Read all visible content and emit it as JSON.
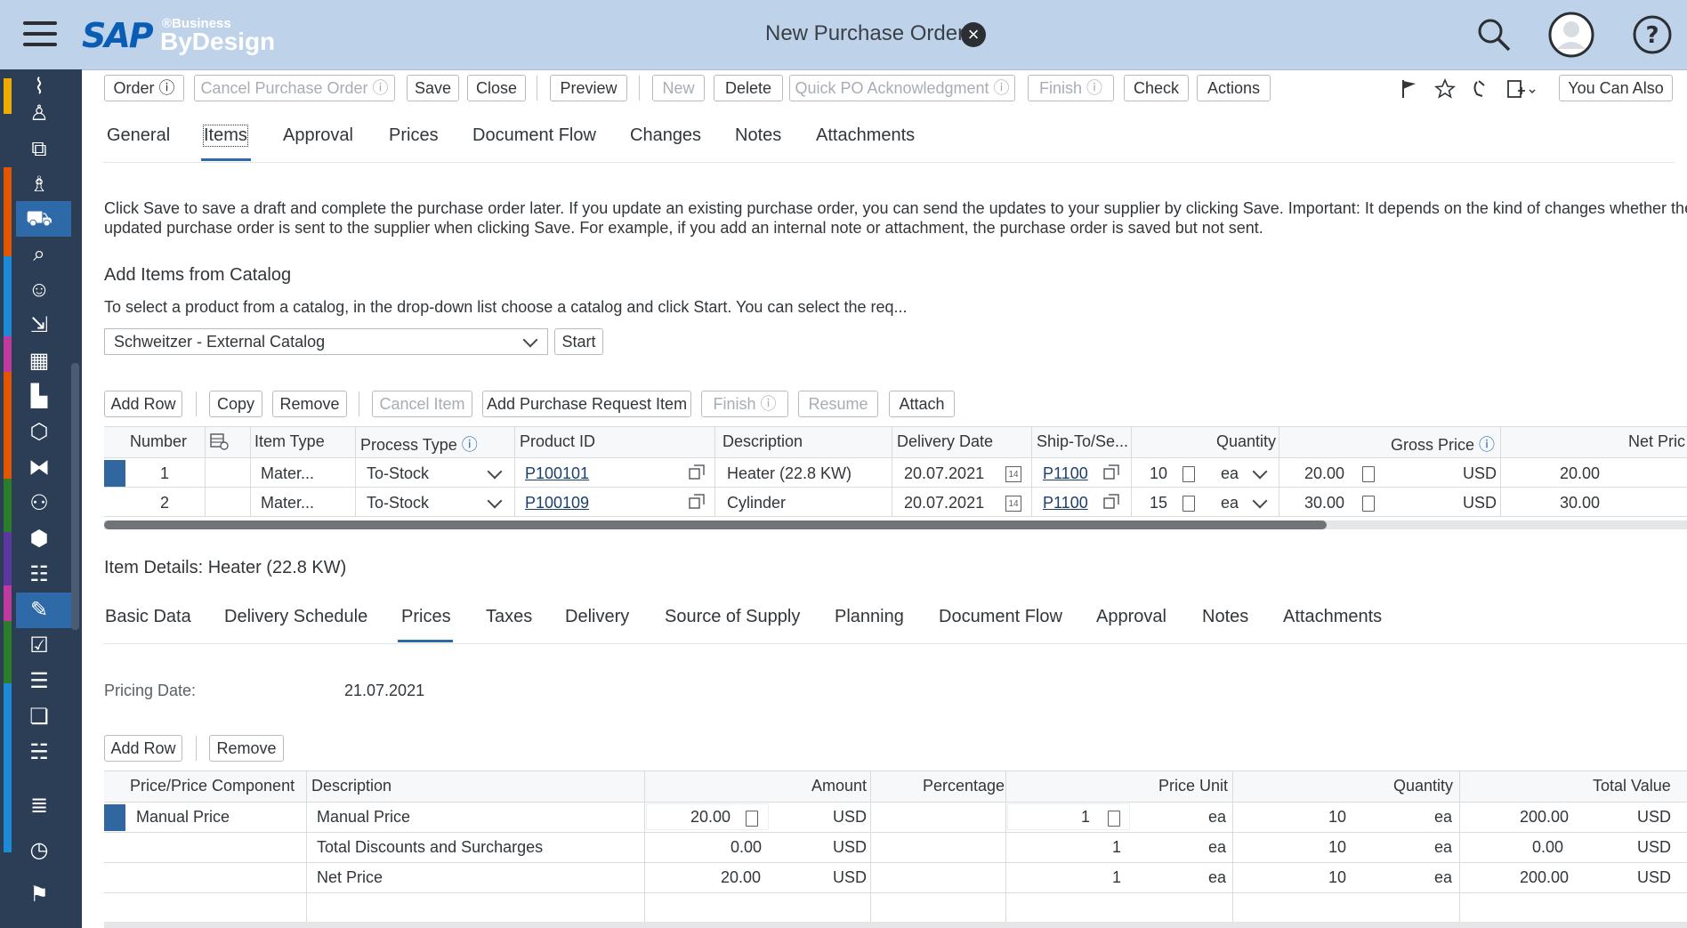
{
  "header": {
    "logo_sap": "SAP",
    "logo_business": "®Business",
    "logo_bydesign": "ByDesign",
    "title": "New Purchase Order"
  },
  "toolbar": {
    "order": "Order",
    "cancel_po": "Cancel Purchase Order",
    "save": "Save",
    "close": "Close",
    "preview": "Preview",
    "new": "New",
    "delete": "Delete",
    "quick_po_ack": "Quick PO Acknowledgment",
    "finish": "Finish",
    "check": "Check",
    "actions": "Actions",
    "you_can_also": "You Can Also"
  },
  "main_tabs": [
    "General",
    "Items",
    "Approval",
    "Prices",
    "Document Flow",
    "Changes",
    "Notes",
    "Attachments"
  ],
  "info_text_1": "Click Save to save a draft and complete the purchase order later. If you update an existing purchase order, you can send the updates to your supplier by clicking Save. Important: It depends on the kind of changes whether the",
  "info_text_2": "updated purchase order is sent to the supplier when clicking Save. For example, if you add an internal note or attachment, the purchase order is saved but not sent.",
  "catalog": {
    "heading": "Add Items from Catalog",
    "hint": "To select a product from a catalog, in the drop-down list choose a catalog and click Start. You can select the req...",
    "selected": "Schweitzer - External Catalog",
    "start": "Start"
  },
  "items_toolbar": {
    "add_row": "Add Row",
    "copy": "Copy",
    "remove": "Remove",
    "cancel_item": "Cancel Item",
    "add_pr_item": "Add Purchase Request Item",
    "finish": "Finish",
    "resume": "Resume",
    "attach": "Attach"
  },
  "items_table": {
    "headers": {
      "number": "Number",
      "item_type": "Item Type",
      "process_type": "Process Type",
      "product_id": "Product ID",
      "description": "Description",
      "delivery_date": "Delivery Date",
      "ship_to": "Ship-To/Se...",
      "quantity": "Quantity",
      "gross_price": "Gross Price",
      "net_price": "Net Pric"
    },
    "rows": [
      {
        "number": "1",
        "item_type": "Mater...",
        "process_type": "To-Stock",
        "product_id": "P100101",
        "description": "Heater (22.8 KW)",
        "delivery_date": "20.07.2021",
        "date_icon": "14",
        "ship_to": "P1100",
        "qty": "10",
        "unit": "ea",
        "gross": "20.00",
        "currency": "USD",
        "net": "20.00"
      },
      {
        "number": "2",
        "item_type": "Mater...",
        "process_type": "To-Stock",
        "product_id": "P100109",
        "description": "Cylinder",
        "delivery_date": "20.07.2021",
        "date_icon": "14",
        "ship_to": "P1100",
        "qty": "15",
        "unit": "ea",
        "gross": "30.00",
        "currency": "USD",
        "net": "30.00"
      }
    ]
  },
  "item_details": {
    "heading": "Item Details: Heater (22.8 KW)",
    "tabs": [
      "Basic Data",
      "Delivery Schedule",
      "Prices",
      "Taxes",
      "Delivery",
      "Source of Supply",
      "Planning",
      "Document Flow",
      "Approval",
      "Notes",
      "Attachments"
    ],
    "pricing_date_label": "Pricing Date:",
    "pricing_date": "21.07.2021",
    "add_row": "Add Row",
    "remove": "Remove"
  },
  "price_table": {
    "headers": {
      "component": "Price/Price Component",
      "description": "Description",
      "amount": "Amount",
      "percentage": "Percentage",
      "price_unit": "Price Unit",
      "quantity": "Quantity",
      "total_value": "Total Value"
    },
    "rows": [
      {
        "component": "Manual Price",
        "description": "Manual Price",
        "amount": "20.00",
        "amount_cur": "USD",
        "price_unit": "1",
        "pu_uom": "ea",
        "qty": "10",
        "qty_uom": "ea",
        "total": "200.00",
        "total_cur": "USD"
      },
      {
        "component": "",
        "description": "Total Discounts and Surcharges",
        "amount": "0.00",
        "amount_cur": "USD",
        "price_unit": "1",
        "pu_uom": "ea",
        "qty": "10",
        "qty_uom": "ea",
        "total": "0.00",
        "total_cur": "USD"
      },
      {
        "component": "",
        "description": "Net Price",
        "amount": "20.00",
        "amount_cur": "USD",
        "price_unit": "1",
        "pu_uom": "ea",
        "qty": "10",
        "qty_uom": "ea",
        "total": "200.00",
        "total_cur": "USD"
      }
    ]
  },
  "colors": {
    "topbar": "#bed2ea",
    "sidebar": "#2b3e55",
    "accent": "#2f6aa8"
  }
}
